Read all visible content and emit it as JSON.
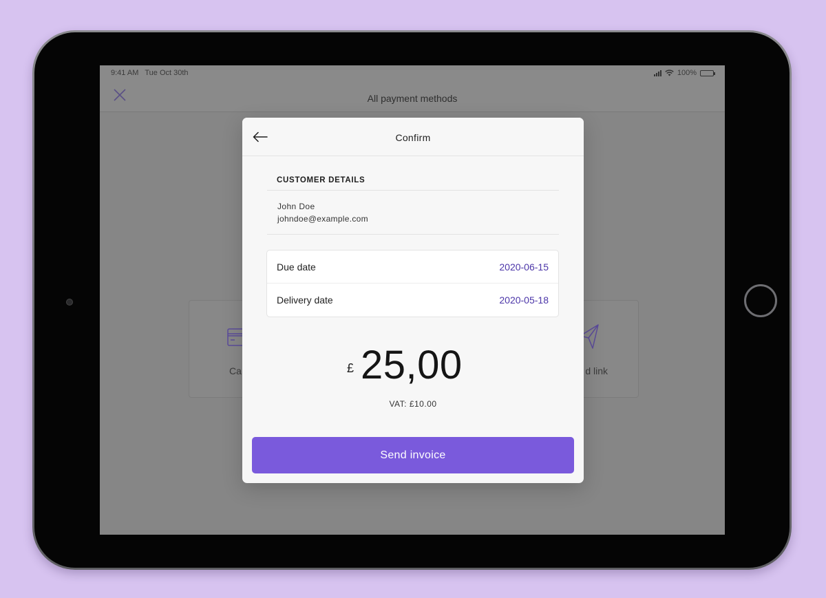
{
  "status_bar": {
    "time": "9:41 AM",
    "date": "Tue Oct 30th",
    "battery": "100%"
  },
  "top_bar": {
    "title": "All payment methods",
    "close_icon": "close-icon"
  },
  "background_cards": [
    {
      "label": "Ca",
      "icon": "credit-card-icon"
    },
    {
      "label": "d link",
      "icon": "paper-plane-icon"
    }
  ],
  "modal": {
    "title": "Confirm",
    "back_icon": "arrow-left-icon",
    "customer": {
      "section_title": "CUSTOMER DETAILS",
      "name": "John Doe",
      "email": "johndoe@example.com"
    },
    "dates": [
      {
        "label": "Due date",
        "value": "2020-06-15"
      },
      {
        "label": "Delivery date",
        "value": "2020-05-18"
      }
    ],
    "amount": {
      "currency": "£",
      "value": "25,00",
      "vat": "VAT: £10.00"
    },
    "send_button": "Send invoice"
  },
  "colors": {
    "background": "#d7c3f0",
    "accent": "#7a5adc",
    "date_value": "#4b35a8"
  }
}
